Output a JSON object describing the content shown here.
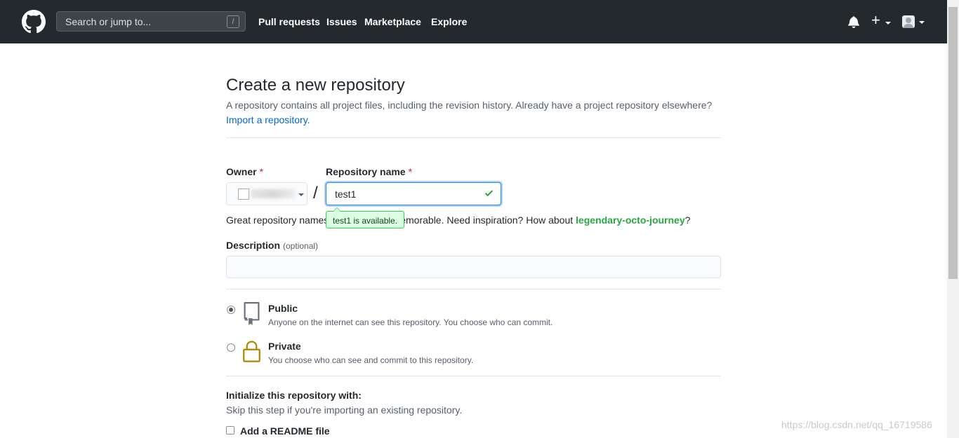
{
  "header": {
    "search_placeholder": "Search or jump to...",
    "search_shortcut": "/",
    "nav": [
      "Pull requests",
      "Issues",
      "Marketplace",
      "Explore"
    ],
    "plus_label": "+"
  },
  "page": {
    "title": "Create a new repository",
    "description": "A repository contains all project files, including the revision history. Already have a project repository elsewhere?",
    "import_link": "Import a repository."
  },
  "form": {
    "owner_label": "Owner",
    "required_mark": "*",
    "repo_name_label": "Repository name",
    "repo_name_value": "test1",
    "separator": "/",
    "availability_tooltip": "test1 is available.",
    "help_text_start": "Great repository names are short and memorable. Need inspiration? How about ",
    "suggested_name": "legendary-octo-journey",
    "help_text_end": "?",
    "description_label": "Description",
    "description_optional": "(optional)",
    "description_value": ""
  },
  "visibility": {
    "selected": "public",
    "public_title": "Public",
    "public_sub": "Anyone on the internet can see this repository. You choose who can commit.",
    "private_title": "Private",
    "private_sub": "You choose who can see and commit to this repository."
  },
  "init": {
    "title": "Initialize this repository with:",
    "subtitle": "Skip this step if you're importing an existing repository.",
    "readme_label": "Add a README file",
    "readme_checked": false
  },
  "watermark": "https://blog.csdn.net/qq_16719586",
  "colors": {
    "header_bg": "#24292e",
    "link": "#0366d6",
    "success": "#28a745",
    "required": "#cb2431",
    "lock": "#b08800"
  }
}
